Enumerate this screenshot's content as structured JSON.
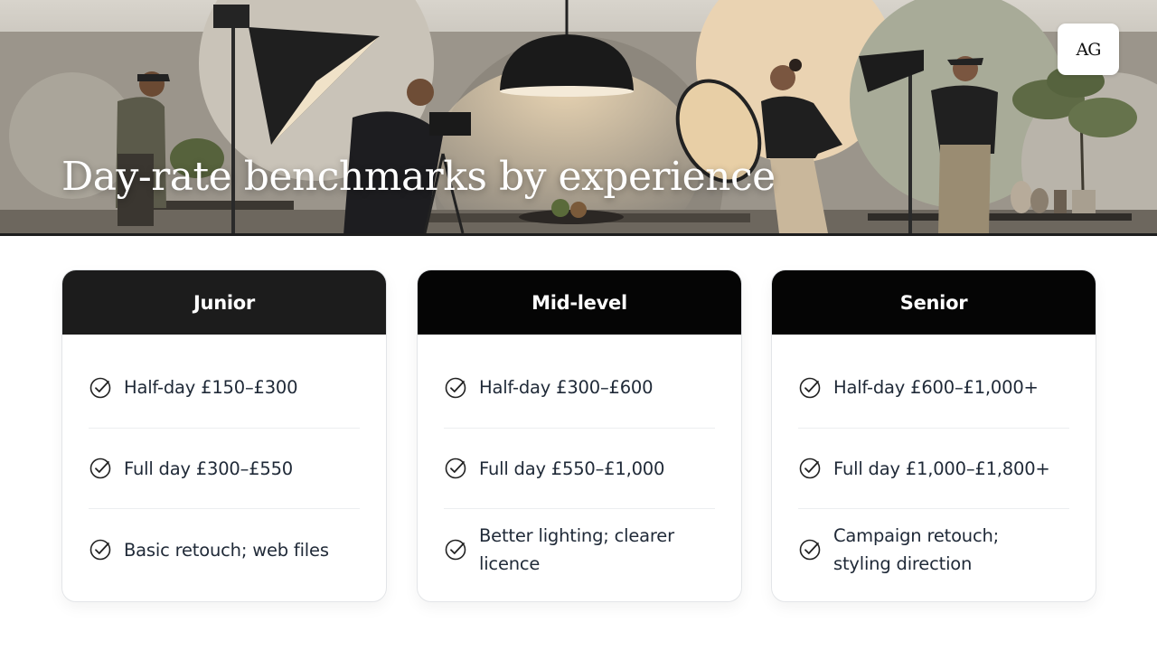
{
  "hero": {
    "title": "Day-rate benchmarks by experience",
    "logo": "AG"
  },
  "tiers": [
    {
      "name": "Junior",
      "items": [
        {
          "text": "Half-day £150–£300",
          "icon": "check-circle-icon"
        },
        {
          "text": "Full day £300–£550",
          "icon": "check-circle-icon"
        },
        {
          "text": "Basic retouch; web files",
          "icon": "check-circle-icon"
        }
      ]
    },
    {
      "name": "Mid-level",
      "items": [
        {
          "text": "Half-day £300–£600",
          "icon": "check-circle-icon"
        },
        {
          "text": "Full day £550–£1,000",
          "icon": "check-circle-icon"
        },
        {
          "text": "Better lighting; clearer licence",
          "icon": "check-circle-icon"
        }
      ]
    },
    {
      "name": "Senior",
      "items": [
        {
          "text": "Half-day £600–£1,000+",
          "icon": "check-circle-icon"
        },
        {
          "text": "Full day £1,000–£1,800+",
          "icon": "check-circle-icon"
        },
        {
          "text": "Campaign retouch; styling direction",
          "icon": "check-circle-icon"
        }
      ]
    }
  ],
  "colors": {
    "header_dark": "#1c1c1c",
    "header_black": "#050505",
    "text": "#1f2937",
    "accent_peach": "#e6cfb0"
  }
}
